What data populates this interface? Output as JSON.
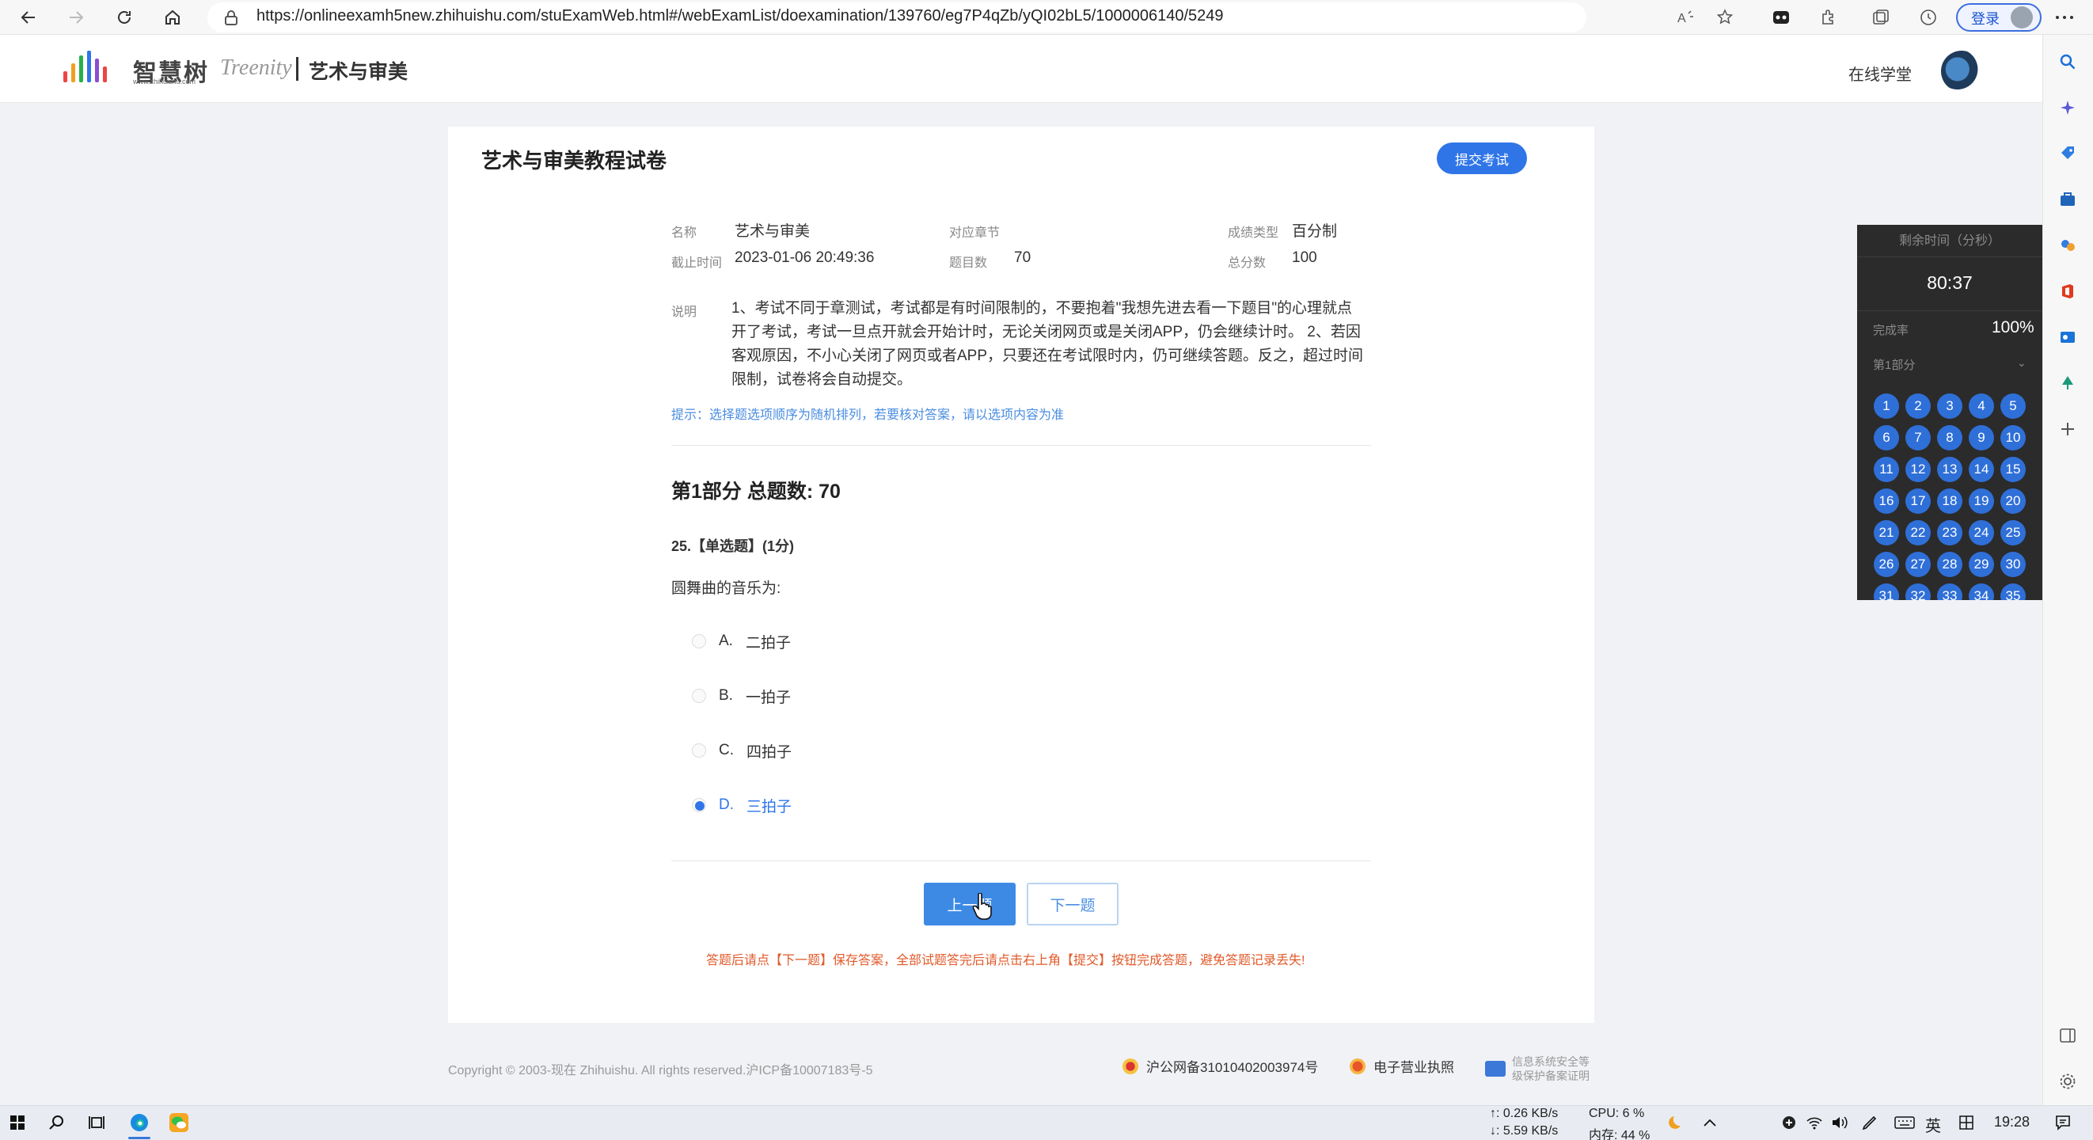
{
  "browser": {
    "url": "https://onlineexamh5new.zhihuishu.com/stuExamWeb.html#/webExamList/doexamination/139760/eg7P4qZb/yQI02bL5/1000006140/5249",
    "login_label": "登录"
  },
  "header": {
    "logo_cn": "智慧树",
    "logo_url": "www.zhihuishu.com",
    "logo_brand": "Treenity",
    "course_name": "艺术与审美",
    "online_school": "在线学堂"
  },
  "exam": {
    "title": "艺术与审美教程试卷",
    "submit_label": "提交考试",
    "meta": {
      "name_label": "名称",
      "name_value": "艺术与审美",
      "chapter_label": "对应章节",
      "score_type_label": "成绩类型",
      "score_type_value": "百分制",
      "deadline_label": "截止时间",
      "deadline_value": "2023-01-06 20:49:36",
      "question_count_label": "题目数",
      "question_count_value": "70",
      "total_score_label": "总分数",
      "total_score_value": "100"
    },
    "description_label": "说明",
    "description": "1、考试不同于章测试，考试都是有时间限制的，不要抱着\"我想先进去看一下题目\"的心理就点开了考试，考试一旦点开就会开始计时，无论关闭网页或是关闭APP，仍会继续计时。 2、若因客观原因，不小心关闭了网页或者APP，只要还在考试限时内，仍可继续答题。反之，超过时间限制，试卷将会自动提交。",
    "hint": "提示：选择题选项顺序为随机排列，若要核对答案，请以选项内容为准",
    "part_title": "第1部分  总题数: 70",
    "question": {
      "header": "25.【单选题】(1分)",
      "stem": "圆舞曲的音乐为:",
      "options": [
        {
          "letter": "A.",
          "text": "二拍子",
          "selected": false
        },
        {
          "letter": "B.",
          "text": "一拍子",
          "selected": false
        },
        {
          "letter": "C.",
          "text": "四拍子",
          "selected": false
        },
        {
          "letter": "D.",
          "text": "三拍子",
          "selected": true
        }
      ]
    },
    "prev_label": "上一题",
    "next_label": "下一题",
    "warning": "答题后请点【下一题】保存答案，全部试题答完后请点击右上角【提交】按钮完成答题，避免答题记录丢失!"
  },
  "footer": {
    "copyright": "Copyright © 2003-现在 Zhihuishu. All rights reserved.沪ICP备10007183号-5",
    "police": "沪公网备31010402003974号",
    "license": "电子营业执照",
    "security_line1": "信息系统安全等",
    "security_line2": "级保护备案证明"
  },
  "timer_panel": {
    "remaining_label": "剩余时间（分秒）",
    "remaining_value": "80:37",
    "completion_label": "完成率",
    "completion_value": "100%",
    "part_label": "第1部分",
    "question_numbers": [
      "1",
      "2",
      "3",
      "4",
      "5",
      "6",
      "7",
      "8",
      "9",
      "10",
      "11",
      "12",
      "13",
      "14",
      "15",
      "16",
      "17",
      "18",
      "19",
      "20",
      "21",
      "22",
      "23",
      "24",
      "25",
      "26",
      "27",
      "28",
      "29",
      "30",
      "31",
      "32",
      "33",
      "34",
      "35"
    ]
  },
  "taskbar": {
    "upload_speed": "↑: 0.26 KB/s",
    "download_speed": "↓: 5.59 KB/s",
    "cpu": "CPU: 6 %",
    "memory": "内存: 44 %",
    "ime_lang": "英",
    "time": "19:28"
  },
  "colors": {
    "accent": "#2f75e8",
    "warning": "#e05a2a",
    "timer_bg": "#2b2b2b"
  }
}
